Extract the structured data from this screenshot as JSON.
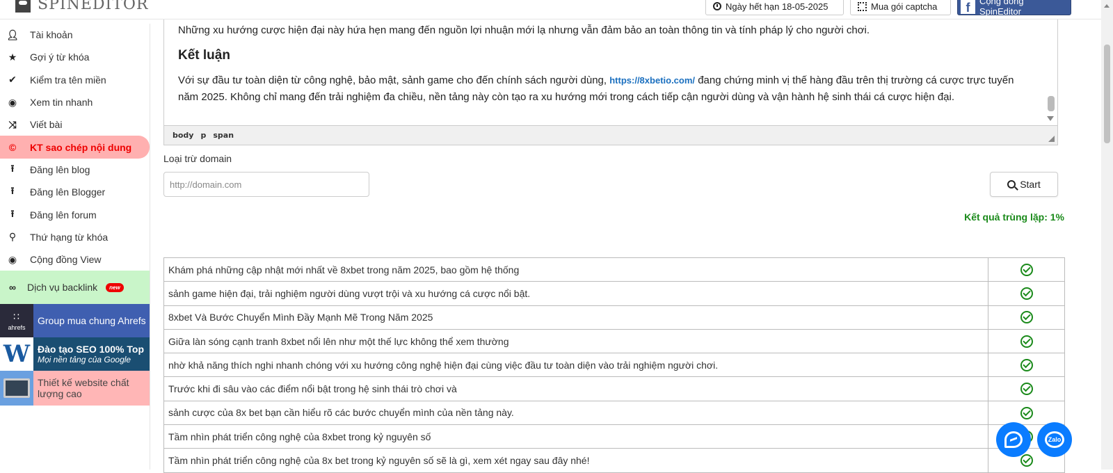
{
  "header": {
    "logo_text": "SPINEDITOR",
    "expiry_label": "Ngày hết hạn 18-05-2025",
    "captcha_label": "Mua gói captcha",
    "community_label": "Cộng đồng SpinEditor",
    "fb_icon": "f"
  },
  "sidebar": {
    "items": [
      {
        "label": "Tài khoản",
        "icon": "user-icon"
      },
      {
        "label": "Gợi ý từ khóa",
        "icon": "star-icon"
      },
      {
        "label": "Kiểm tra tên miền",
        "icon": "check-icon"
      },
      {
        "label": "Xem tin nhanh",
        "icon": "eye-icon"
      },
      {
        "label": "Viết bài",
        "icon": "shuffle-icon"
      },
      {
        "label": "KT sao chép nội dung",
        "icon": "copyright-icon"
      },
      {
        "label": "Đăng lên blog",
        "icon": "upload-icon"
      },
      {
        "label": "Đăng lên Blogger",
        "icon": "upload-icon"
      },
      {
        "label": "Đăng lên forum",
        "icon": "upload-icon"
      },
      {
        "label": "Thứ hạng từ khóa",
        "icon": "search-icon"
      },
      {
        "label": "Cộng đồng View",
        "icon": "eye-icon"
      }
    ],
    "backlink": {
      "label": "Dịch vụ backlink",
      "badge": "new",
      "icon": "link-icon"
    },
    "promos": {
      "ahrefs": {
        "label": "Group mua chung Ahrefs",
        "logo_text": "ahrefs"
      },
      "seo": {
        "title": "Đào tạo SEO 100% Top",
        "subtitle": "Mọi nền tảng của Google",
        "logo_text": "W"
      },
      "web": {
        "label": "Thiết kế website chất lượng cao"
      }
    }
  },
  "editor": {
    "para1": "Những xu hướng cược hiện đại này hứa hẹn mang đến nguồn lợi nhuận mới lạ nhưng vẫn đảm bảo an toàn thông tin và tính pháp lý cho người chơi.",
    "heading": "Kết luận",
    "para2_before": "Với sự đầu tư toàn diện từ công nghệ, bảo mật, sảnh game cho đến chính sách người dùng, ",
    "para2_link": "https://8xbetio.com/",
    "para2_after": " đang chứng minh vị thế hàng đầu trên thị trường cá cược trực tuyến năm 2025. Không chỉ mang đến trải nghiệm đa chiều, nền tảng này còn tạo ra xu hướng mới trong cách tiếp cận người dùng và vận hành hệ sinh thái cá cược hiện đại.",
    "path": [
      "body",
      "p",
      "span"
    ]
  },
  "form": {
    "exclude_label": "Loại trừ domain",
    "domain_placeholder": "http://domain.com",
    "start_label": "Start",
    "result_text": "Kết quả trùng lặp: 1%"
  },
  "results": [
    "Khám phá những cập nhật mới nhất về 8xbet trong năm 2025, bao gồm hệ thống",
    "sảnh game hiện đại, trải nghiệm người dùng vượt trội và xu hướng cá cược nổi bật.",
    "8xbet Và Bước Chuyển Mình Đầy Mạnh Mẽ Trong Năm 2025",
    "Giữa làn sóng cạnh tranh 8xbet nổi lên như một thế lực không thể xem thường",
    "nhờ khả năng thích nghi nhanh chóng với xu hướng công nghệ hiện đại cùng việc đầu tư toàn diện vào trải nghiệm người chơi.",
    "Trước khi đi sâu vào các điểm nổi bật trong hệ sinh thái trò chơi và",
    "sảnh cược của 8x bet bạn cần hiểu rõ các bước chuyển mình của nền tảng này.",
    "Tầm nhìn phát triển công nghệ của 8xbet trong kỷ nguyên số",
    "Tầm nhìn phát triển công nghệ của 8x bet trong kỷ nguyên số sẽ là gì, xem xét ngay sau đây nhé!"
  ],
  "chat": {
    "zalo_label": "Zalo"
  },
  "colors": {
    "accent_green": "#1a8a1a",
    "active_red": "#e00000",
    "facebook": "#3b5998",
    "chat_blue": "#0a7cff"
  }
}
